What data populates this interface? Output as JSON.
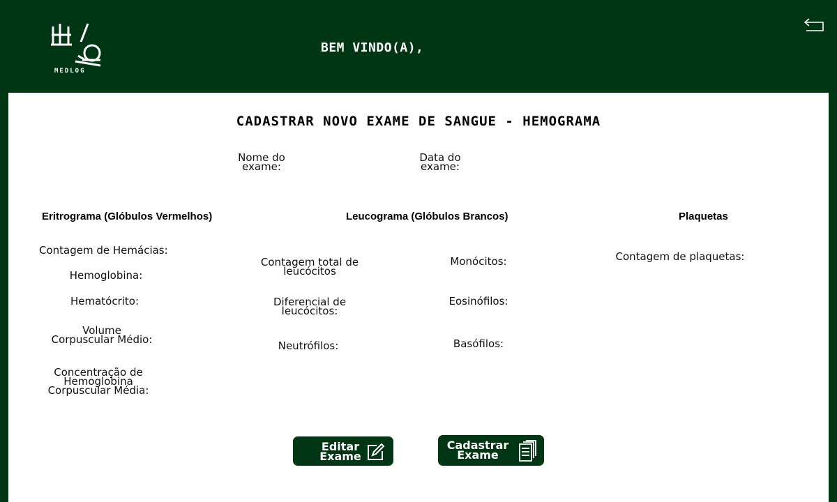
{
  "header": {
    "logo_text": "MEDLOG",
    "welcome": "BEM VINDO(A),"
  },
  "form": {
    "title": "CADASTRAR NOVO EXAME DE SANGUE - HEMOGRAMA",
    "exam_name_label": "Nome do exame:",
    "exam_date_label": "Data do exame:"
  },
  "sections": {
    "erythrogram": {
      "title": "Eritrograma (Glóbulos Vermelhos)",
      "fields": [
        "Contagem de Hemácias:",
        "Hemoglobina:",
        "Hematócrito:",
        "Volume Corpuscular Médio:",
        "Concentração de Hemoglobina Corpuscular Média:"
      ]
    },
    "leukogram": {
      "title": "Leucograma (Glóbulos Brancos)",
      "fields": [
        "Contagem total de leucócitos",
        "Diferencial de leucócitos:",
        "Neutrófilos:",
        "Monócitos:",
        "Eosinófilos:",
        "Basófilos:"
      ]
    },
    "platelets": {
      "title": "Plaquetas",
      "fields": [
        "Contagem de plaquetas:"
      ]
    }
  },
  "buttons": {
    "edit": "Editar Exame",
    "register": "Cadastrar Exame"
  }
}
